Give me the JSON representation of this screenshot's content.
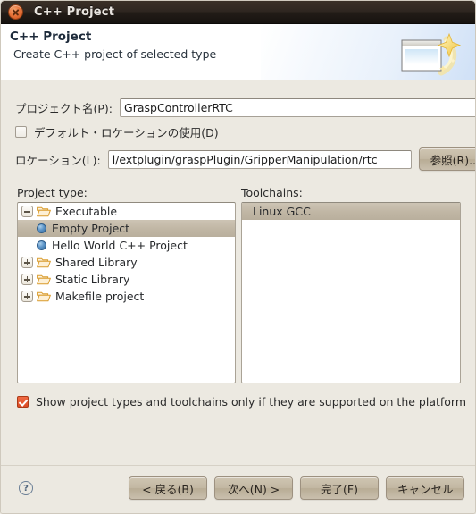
{
  "window": {
    "title": "C++ Project",
    "close_icon": "close-icon"
  },
  "banner": {
    "title": "C++ Project",
    "subtitle": "Create C++ project of selected type",
    "icon": "new-project-wizard-icon"
  },
  "form": {
    "project_name_label": "プロジェクト名(P):",
    "project_name_value": "GraspControllerRTC",
    "project_name_placeholder": "",
    "use_default_location_label": "デフォルト・ロケーションの使用(D)",
    "use_default_location_checked": false,
    "location_label": "ロケーション(L):",
    "location_value": "l/extplugin/graspPlugin/GripperManipulation/rtc",
    "location_placeholder": "",
    "browse_button": "参照(R)..."
  },
  "project_type": {
    "label": "Project type:",
    "items": [
      {
        "label": "Executable",
        "kind": "folder",
        "expander": "minus",
        "depth": 0,
        "selected": false
      },
      {
        "label": "Empty Project",
        "kind": "leaf",
        "expander": "none",
        "depth": 1,
        "selected": true
      },
      {
        "label": "Hello World C++ Project",
        "kind": "leaf",
        "expander": "none",
        "depth": 1,
        "selected": false
      },
      {
        "label": "Shared Library",
        "kind": "folder",
        "expander": "plus",
        "depth": 0,
        "selected": false
      },
      {
        "label": "Static Library",
        "kind": "folder",
        "expander": "plus",
        "depth": 0,
        "selected": false
      },
      {
        "label": "Makefile project",
        "kind": "folder",
        "expander": "plus",
        "depth": 0,
        "selected": false
      }
    ]
  },
  "toolchains": {
    "label": "Toolchains:",
    "items": [
      {
        "label": "Linux GCC",
        "selected": true
      }
    ]
  },
  "options": {
    "show_supported_label": "Show project types and toolchains only if they are supported on the platform",
    "show_supported_checked": true
  },
  "footer": {
    "help_icon": "help-icon",
    "back_button": "< 戻る(B)",
    "next_button": "次へ(N) >",
    "finish_button": "完了(F)",
    "cancel_button": "キャンセル"
  },
  "colors": {
    "dialog_bg": "#ece9e1",
    "titlebar": "#241e19",
    "accent_checkbox": "#e0521f",
    "selection": "#c0b6a4",
    "button_face": "#c3b8a3",
    "folder": "#e8a33d"
  }
}
